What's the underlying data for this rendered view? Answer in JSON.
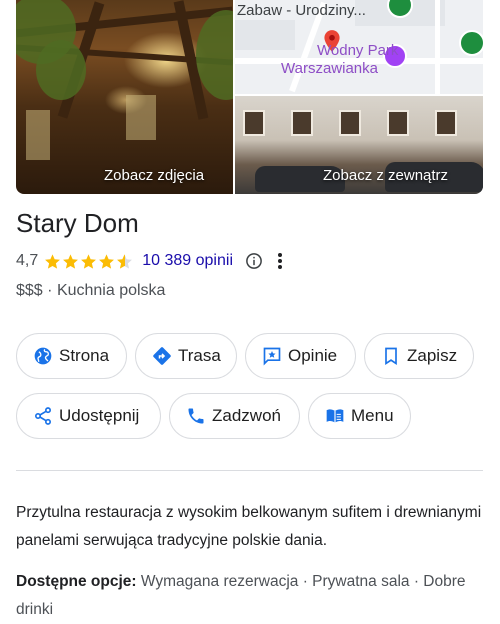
{
  "photos": {
    "main_label": "Zobacz zdjęcia",
    "street_label": "Zobacz z zewnątrz",
    "map": {
      "top_text": "Zabaw - Urodziny...",
      "poi_line1": "Wodny Park",
      "poi_line2": "Warszawianka"
    }
  },
  "place": {
    "name": "Stary Dom",
    "rating": "4,7",
    "stars_filled": 4.5,
    "reviews": "10 389 opinii",
    "price": "$$$",
    "separator": "·",
    "category": "Kuchnia polska"
  },
  "actions": {
    "website": "Strona",
    "directions": "Trasa",
    "reviews": "Opinie",
    "save": "Zapisz",
    "share": "Udostępnij",
    "call": "Zadzwoń",
    "menu": "Menu"
  },
  "description": "Przytulna restauracja z wysokim belkowanym sufitem i drewnianymi panelami serwująca tradycyjne polskie dania.",
  "options": {
    "label": "Dostępne opcje:",
    "value": "Wymagana rezerwacja · Prywatna sala · Dobre drinki"
  },
  "colors": {
    "accent_blue": "#1a73e8",
    "link_blue": "#1a0dab",
    "star": "#fbbc04",
    "map_pin": "#ea4335"
  }
}
